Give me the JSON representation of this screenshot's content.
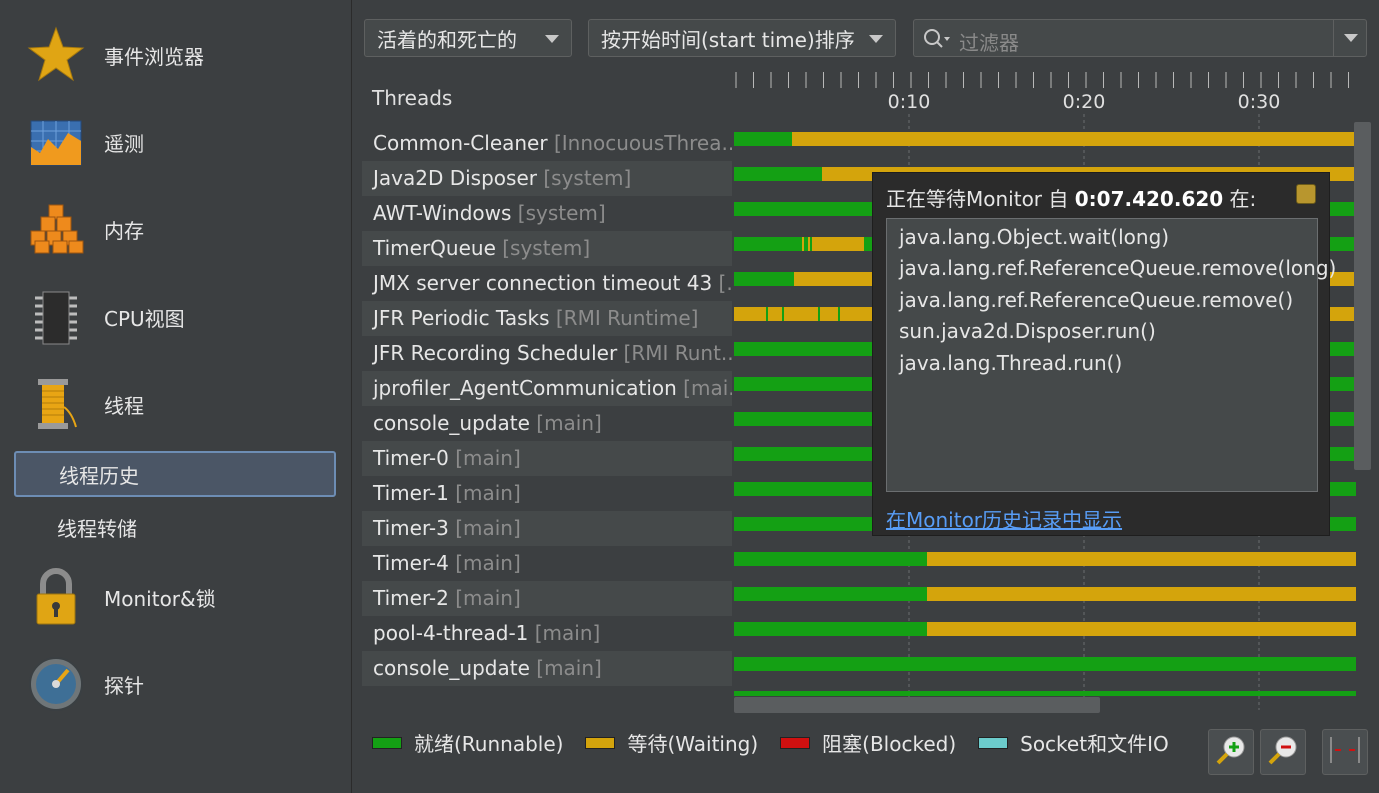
{
  "sidebar": {
    "items": [
      {
        "label": "事件浏览器",
        "icon": "star-icon"
      },
      {
        "label": "遥测",
        "icon": "telemetry-chart-icon"
      },
      {
        "label": "内存",
        "icon": "memory-blocks-icon"
      },
      {
        "label": "CPU视图",
        "icon": "cpu-chip-icon"
      },
      {
        "label": "线程",
        "icon": "thread-spool-icon"
      }
    ],
    "sub_items": [
      {
        "label": "线程历史",
        "selected": true
      },
      {
        "label": "线程转储",
        "selected": false
      }
    ],
    "items2": [
      {
        "label": "Monitor&锁",
        "icon": "padlock-icon"
      },
      {
        "label": "探针",
        "icon": "gauge-icon"
      }
    ]
  },
  "toolbar": {
    "state_filter": "活着的和死亡的",
    "sort_order": "按开始时间(start time)排序",
    "filter_placeholder": "过滤器"
  },
  "timeline": {
    "header": "Threads",
    "ticks": [
      "0:10",
      "0:20",
      "0:30"
    ]
  },
  "threads": [
    {
      "name": "Common-Cleaner",
      "group": "[InnocuousThrea..."
    },
    {
      "name": "Java2D Disposer",
      "group": "[system]"
    },
    {
      "name": "AWT-Windows",
      "group": "[system]"
    },
    {
      "name": "TimerQueue",
      "group": "[system]"
    },
    {
      "name": "JMX server connection timeout 43",
      "group": "[..."
    },
    {
      "name": "JFR Periodic Tasks",
      "group": "[RMI Runtime]"
    },
    {
      "name": "JFR Recording Scheduler",
      "group": "[RMI Runt..."
    },
    {
      "name": "jprofiler_AgentCommunication",
      "group": "[mai..."
    },
    {
      "name": "console_update",
      "group": "[main]"
    },
    {
      "name": "Timer-0",
      "group": "[main]"
    },
    {
      "name": "Timer-1",
      "group": "[main]"
    },
    {
      "name": "Timer-3",
      "group": "[main]"
    },
    {
      "name": "Timer-4",
      "group": "[main]"
    },
    {
      "name": "Timer-2",
      "group": "[main]"
    },
    {
      "name": "pool-4-thread-1",
      "group": "[main]"
    },
    {
      "name": "console_update",
      "group": "[main]"
    }
  ],
  "legend": [
    {
      "label": "就绪(Runnable)",
      "color": "#14a014"
    },
    {
      "label": "等待(Waiting)",
      "color": "#d4a40c"
    },
    {
      "label": "阻塞(Blocked)",
      "color": "#d01010"
    },
    {
      "label": "Socket和文件IO",
      "color": "#6ccccc"
    }
  ],
  "tooltip": {
    "title_prefix": "正在等待Monitor 自 ",
    "time": "0:07.420.620",
    "title_suffix": " 在:",
    "frames": [
      "java.lang.Object.wait(long)",
      "java.lang.ref.ReferenceQueue.remove(long)",
      "java.lang.ref.ReferenceQueue.remove()",
      "sun.java2d.Disposer.run()",
      "java.lang.Thread.run()"
    ],
    "link": "在Monitor历史记录中显示"
  },
  "buttons": {
    "zoom_in": "zoom-in-icon",
    "zoom_out": "zoom-out-icon",
    "fit": "fit-width-icon"
  },
  "colors": {
    "runnable": "#14a014",
    "waiting": "#d4a40c",
    "blocked": "#d01010",
    "io": "#6ccccc",
    "accent": "#589df6"
  }
}
